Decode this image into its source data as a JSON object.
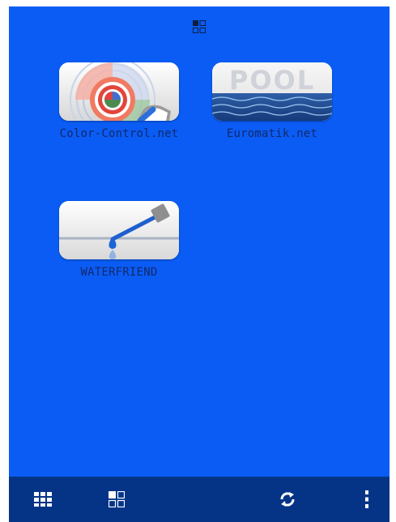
{
  "apps": [
    {
      "label": "Color-Control.net",
      "icon": "color-control-icon"
    },
    {
      "label": "Euromatik.net",
      "icon": "pool-icon",
      "icon_text": "POOL"
    },
    {
      "label": "WATERFRIEND",
      "icon": "waterfriend-icon"
    }
  ],
  "toolbar": {
    "grid_view": "grid-view-icon",
    "tile_view": "tile-view-icon",
    "refresh": "refresh-icon",
    "more": "more-vertical-icon"
  },
  "colors": {
    "background": "#0a5cf5",
    "bottom_bar": "#053487",
    "label": "#13296a",
    "icon_white": "#ffffff"
  }
}
